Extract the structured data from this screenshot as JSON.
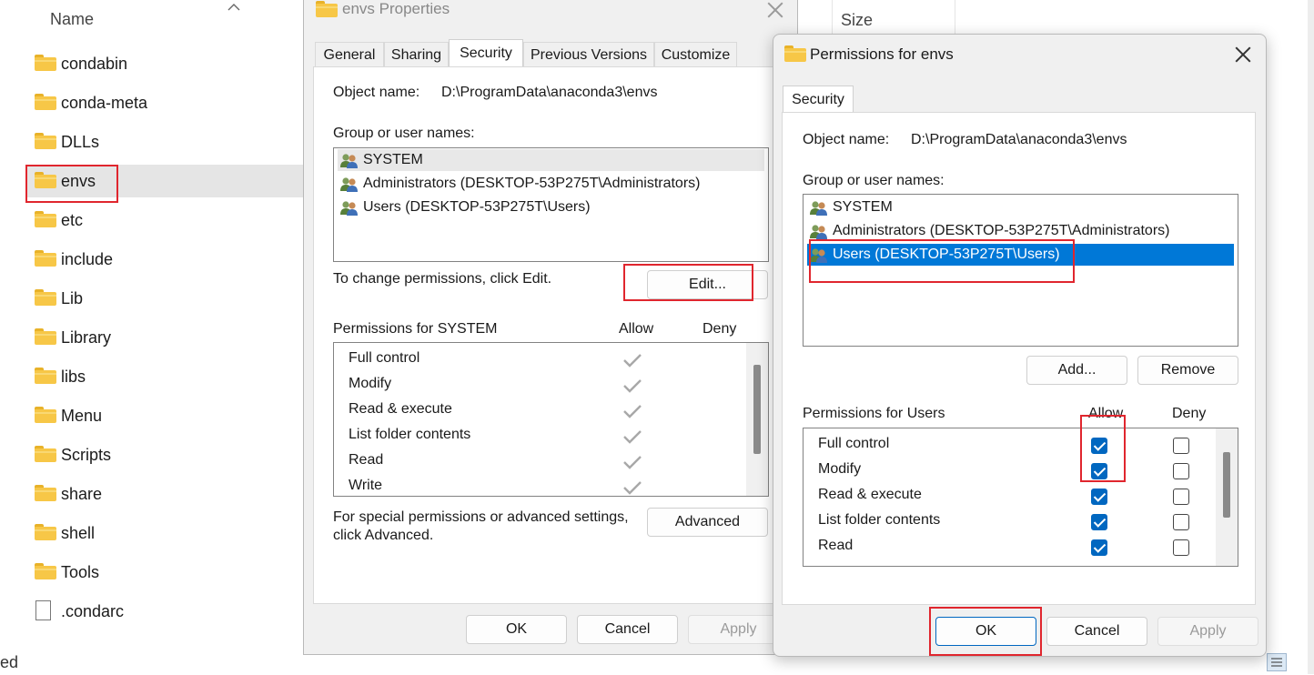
{
  "explorer": {
    "header_name": "Name",
    "items": [
      {
        "label": "condabin",
        "type": "folder"
      },
      {
        "label": "conda-meta",
        "type": "folder"
      },
      {
        "label": "DLLs",
        "type": "folder"
      },
      {
        "label": "envs",
        "type": "folder"
      },
      {
        "label": "etc",
        "type": "folder"
      },
      {
        "label": "include",
        "type": "folder"
      },
      {
        "label": "Lib",
        "type": "folder"
      },
      {
        "label": "Library",
        "type": "folder"
      },
      {
        "label": "libs",
        "type": "folder"
      },
      {
        "label": "Menu",
        "type": "folder"
      },
      {
        "label": "Scripts",
        "type": "folder"
      },
      {
        "label": "share",
        "type": "folder"
      },
      {
        "label": "shell",
        "type": "folder"
      },
      {
        "label": "Tools",
        "type": "folder"
      },
      {
        "label": ".condarc",
        "type": "file"
      }
    ],
    "selected_item": "envs",
    "status_fragment": "ed",
    "size_header": "Size"
  },
  "properties_dialog": {
    "title": "envs Properties",
    "tabs": [
      "General",
      "Sharing",
      "Security",
      "Previous Versions",
      "Customize"
    ],
    "active_tab": "Security",
    "object_name_label": "Object name:",
    "object_name_value": "D:\\ProgramData\\anaconda3\\envs",
    "group_label": "Group or user names:",
    "users": [
      "SYSTEM",
      "Administrators (DESKTOP-53P275T\\Administrators)",
      "Users (DESKTOP-53P275T\\Users)"
    ],
    "change_hint": "To change permissions, click Edit.",
    "edit_button": "Edit...",
    "permissions_label": "Permissions for SYSTEM",
    "allow_header": "Allow",
    "deny_header": "Deny",
    "permissions": [
      {
        "name": "Full control",
        "allow": true,
        "deny": false
      },
      {
        "name": "Modify",
        "allow": true,
        "deny": false
      },
      {
        "name": "Read & execute",
        "allow": true,
        "deny": false
      },
      {
        "name": "List folder contents",
        "allow": true,
        "deny": false
      },
      {
        "name": "Read",
        "allow": true,
        "deny": false
      },
      {
        "name": "Write",
        "allow": true,
        "deny": false
      }
    ],
    "special_hint_line1": "For special permissions or advanced settings,",
    "special_hint_line2": "click Advanced.",
    "advanced_button": "Advanced",
    "ok_button": "OK",
    "cancel_button": "Cancel",
    "apply_button": "Apply"
  },
  "permissions_dialog": {
    "title": "Permissions for envs",
    "tab": "Security",
    "object_name_label": "Object name:",
    "object_name_value": "D:\\ProgramData\\anaconda3\\envs",
    "group_label": "Group or user names:",
    "users": [
      "SYSTEM",
      "Administrators (DESKTOP-53P275T\\Administrators)",
      "Users (DESKTOP-53P275T\\Users)"
    ],
    "selected_user": "Users (DESKTOP-53P275T\\Users)",
    "add_button": "Add...",
    "remove_button": "Remove",
    "permissions_label": "Permissions for Users",
    "allow_header": "Allow",
    "deny_header": "Deny",
    "permissions": [
      {
        "name": "Full control",
        "allow": true,
        "deny": false
      },
      {
        "name": "Modify",
        "allow": true,
        "deny": false
      },
      {
        "name": "Read & execute",
        "allow": true,
        "deny": false
      },
      {
        "name": "List folder contents",
        "allow": true,
        "deny": false
      },
      {
        "name": "Read",
        "allow": true,
        "deny": false
      }
    ],
    "ok_button": "OK",
    "cancel_button": "Cancel",
    "apply_button": "Apply"
  },
  "colors": {
    "highlight": "#0078d7",
    "annotation_red": "#e0262e",
    "checkbox_blue": "#0067c0"
  }
}
